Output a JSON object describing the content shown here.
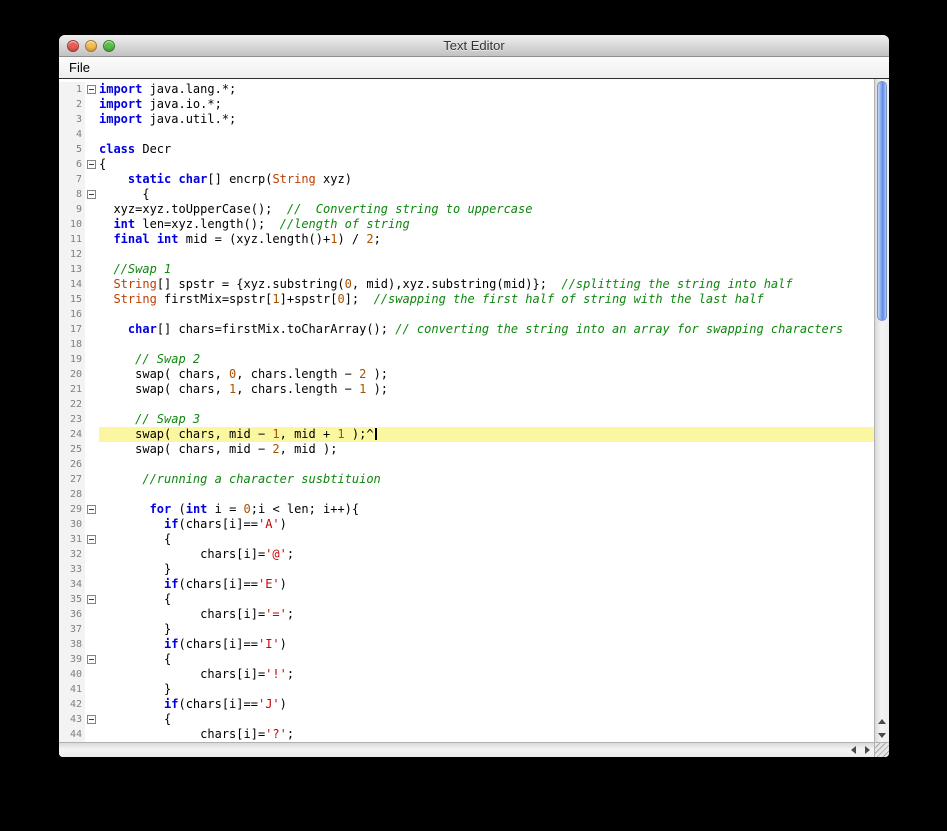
{
  "window": {
    "title": "Text Editor",
    "controls": [
      {
        "name": "close",
        "color": "#ee5c54"
      },
      {
        "name": "minimize",
        "color": "#f6be4e"
      },
      {
        "name": "zoom",
        "color": "#57c146"
      }
    ],
    "menu_items": [
      {
        "label": "File"
      }
    ]
  },
  "editor": {
    "cursor_line": 24,
    "colors": {
      "keyword": "#0000e0",
      "type": "#be3e00",
      "number": "#a85000",
      "char_literal": "#cc0000",
      "comment": "#0e870e",
      "plain": "#000000",
      "current_line_bg": "#fbf7a1",
      "gutter_bg": "#f3f3f3",
      "line_number": "#7f7f7f"
    },
    "lines": [
      {
        "n": 1,
        "f": true,
        "s": [
          [
            "k",
            "import"
          ],
          [
            "p",
            " java.lang.*;"
          ]
        ]
      },
      {
        "n": 2,
        "s": [
          [
            "k",
            "import"
          ],
          [
            "p",
            " java.io.*;"
          ]
        ]
      },
      {
        "n": 3,
        "s": [
          [
            "k",
            "import"
          ],
          [
            "p",
            " java.util.*;"
          ]
        ]
      },
      {
        "n": 4,
        "s": []
      },
      {
        "n": 5,
        "s": [
          [
            "k",
            "class"
          ],
          [
            "p",
            " Decr"
          ]
        ]
      },
      {
        "n": 6,
        "f": true,
        "s": [
          [
            "p",
            "{"
          ]
        ]
      },
      {
        "n": 7,
        "s": [
          [
            "p",
            "    "
          ],
          [
            "k",
            "static"
          ],
          [
            "p",
            " "
          ],
          [
            "k",
            "char"
          ],
          [
            "p",
            "[] encrp("
          ],
          [
            "t",
            "String"
          ],
          [
            "p",
            " xyz)"
          ]
        ]
      },
      {
        "n": 8,
        "f": true,
        "s": [
          [
            "p",
            "      {"
          ]
        ]
      },
      {
        "n": 9,
        "s": [
          [
            "p",
            "  xyz=xyz.toUpperCase();  "
          ],
          [
            "c",
            "//  Converting string to uppercase"
          ]
        ]
      },
      {
        "n": 10,
        "s": [
          [
            "p",
            "  "
          ],
          [
            "k",
            "int"
          ],
          [
            "p",
            " len=xyz.length();  "
          ],
          [
            "c",
            "//length of string"
          ]
        ]
      },
      {
        "n": 11,
        "s": [
          [
            "p",
            "  "
          ],
          [
            "k",
            "final"
          ],
          [
            "p",
            " "
          ],
          [
            "k",
            "int"
          ],
          [
            "p",
            " mid = (xyz.length()+"
          ],
          [
            "n",
            "1"
          ],
          [
            "p",
            ") / "
          ],
          [
            "n",
            "2"
          ],
          [
            "p",
            ";"
          ]
        ]
      },
      {
        "n": 12,
        "s": []
      },
      {
        "n": 13,
        "s": [
          [
            "p",
            "  "
          ],
          [
            "c",
            "//Swap 1"
          ]
        ]
      },
      {
        "n": 14,
        "s": [
          [
            "p",
            "  "
          ],
          [
            "t",
            "String"
          ],
          [
            "p",
            "[] spstr = {xyz.substring("
          ],
          [
            "n",
            "0"
          ],
          [
            "p",
            ", mid),xyz.substring(mid)};  "
          ],
          [
            "c",
            "//splitting the string into half"
          ]
        ]
      },
      {
        "n": 15,
        "s": [
          [
            "p",
            "  "
          ],
          [
            "t",
            "String"
          ],
          [
            "p",
            " firstMix=spstr["
          ],
          [
            "n",
            "1"
          ],
          [
            "p",
            "]+spstr["
          ],
          [
            "n",
            "0"
          ],
          [
            "p",
            "];  "
          ],
          [
            "c",
            "//swapping the first half of string with the last half"
          ]
        ]
      },
      {
        "n": 16,
        "s": []
      },
      {
        "n": 17,
        "s": [
          [
            "p",
            "    "
          ],
          [
            "k",
            "char"
          ],
          [
            "p",
            "[] chars=firstMix.toCharArray(); "
          ],
          [
            "c",
            "// converting the string into an array for swapping characters"
          ]
        ]
      },
      {
        "n": 18,
        "s": []
      },
      {
        "n": 19,
        "s": [
          [
            "p",
            "     "
          ],
          [
            "c",
            "// Swap 2"
          ]
        ]
      },
      {
        "n": 20,
        "s": [
          [
            "p",
            "     swap( chars, "
          ],
          [
            "n",
            "0"
          ],
          [
            "p",
            ", chars.length − "
          ],
          [
            "n",
            "2"
          ],
          [
            "p",
            " );"
          ]
        ]
      },
      {
        "n": 21,
        "s": [
          [
            "p",
            "     swap( chars, "
          ],
          [
            "n",
            "1"
          ],
          [
            "p",
            ", chars.length − "
          ],
          [
            "n",
            "1"
          ],
          [
            "p",
            " );"
          ]
        ]
      },
      {
        "n": 22,
        "s": []
      },
      {
        "n": 23,
        "s": [
          [
            "p",
            "     "
          ],
          [
            "c",
            "// Swap 3"
          ]
        ]
      },
      {
        "n": 24,
        "s": [
          [
            "p",
            "     swap( chars, mid − "
          ],
          [
            "n",
            "1"
          ],
          [
            "p",
            ", mid + "
          ],
          [
            "n",
            "1"
          ],
          [
            "p",
            " );^"
          ]
        ]
      },
      {
        "n": 25,
        "s": [
          [
            "p",
            "     swap( chars, mid − "
          ],
          [
            "n",
            "2"
          ],
          [
            "p",
            ", mid );"
          ]
        ]
      },
      {
        "n": 26,
        "s": []
      },
      {
        "n": 27,
        "s": [
          [
            "p",
            "      "
          ],
          [
            "c",
            "//running a character susbtituion"
          ]
        ]
      },
      {
        "n": 28,
        "s": []
      },
      {
        "n": 29,
        "f": true,
        "s": [
          [
            "p",
            "       "
          ],
          [
            "k",
            "for"
          ],
          [
            "p",
            " ("
          ],
          [
            "k",
            "int"
          ],
          [
            "p",
            " i = "
          ],
          [
            "n",
            "0"
          ],
          [
            "p",
            ";i < len; i++){"
          ]
        ]
      },
      {
        "n": 30,
        "s": [
          [
            "p",
            "         "
          ],
          [
            "k",
            "if"
          ],
          [
            "p",
            "(chars[i]=="
          ],
          [
            "s",
            "'A'"
          ],
          [
            "p",
            ")"
          ]
        ]
      },
      {
        "n": 31,
        "f": true,
        "s": [
          [
            "p",
            "         {"
          ]
        ]
      },
      {
        "n": 32,
        "s": [
          [
            "p",
            "              chars[i]="
          ],
          [
            "s",
            "'@'"
          ],
          [
            "p",
            ";"
          ]
        ]
      },
      {
        "n": 33,
        "s": [
          [
            "p",
            "         }"
          ]
        ]
      },
      {
        "n": 34,
        "s": [
          [
            "p",
            "         "
          ],
          [
            "k",
            "if"
          ],
          [
            "p",
            "(chars[i]=="
          ],
          [
            "s",
            "'E'"
          ],
          [
            "p",
            ")"
          ]
        ]
      },
      {
        "n": 35,
        "f": true,
        "s": [
          [
            "p",
            "         {"
          ]
        ]
      },
      {
        "n": 36,
        "s": [
          [
            "p",
            "              chars[i]="
          ],
          [
            "s",
            "'='"
          ],
          [
            "p",
            ";"
          ]
        ]
      },
      {
        "n": 37,
        "s": [
          [
            "p",
            "         }"
          ]
        ]
      },
      {
        "n": 38,
        "s": [
          [
            "p",
            "         "
          ],
          [
            "k",
            "if"
          ],
          [
            "p",
            "(chars[i]=="
          ],
          [
            "s",
            "'I'"
          ],
          [
            "p",
            ")"
          ]
        ]
      },
      {
        "n": 39,
        "f": true,
        "s": [
          [
            "p",
            "         {"
          ]
        ]
      },
      {
        "n": 40,
        "s": [
          [
            "p",
            "              chars[i]="
          ],
          [
            "s",
            "'!'"
          ],
          [
            "p",
            ";"
          ]
        ]
      },
      {
        "n": 41,
        "s": [
          [
            "p",
            "         }"
          ]
        ]
      },
      {
        "n": 42,
        "s": [
          [
            "p",
            "         "
          ],
          [
            "k",
            "if"
          ],
          [
            "p",
            "(chars[i]=="
          ],
          [
            "s",
            "'J'"
          ],
          [
            "p",
            ")"
          ]
        ]
      },
      {
        "n": 43,
        "f": true,
        "s": [
          [
            "p",
            "         {"
          ]
        ]
      },
      {
        "n": 44,
        "s": [
          [
            "p",
            "              chars[i]="
          ],
          [
            "s",
            "'?'"
          ],
          [
            "p",
            ";"
          ]
        ]
      }
    ]
  }
}
